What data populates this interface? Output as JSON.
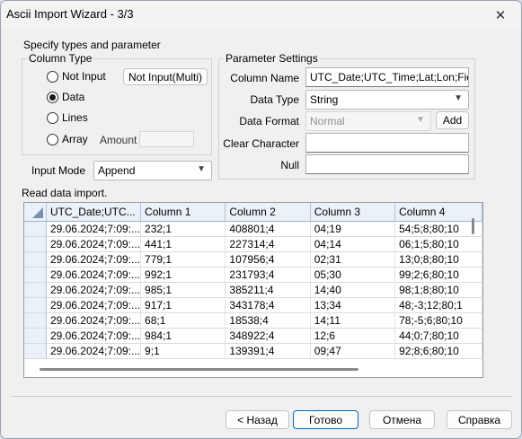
{
  "window": {
    "title": "Ascii Import Wizard  - 3/3",
    "close_symbol": "✕"
  },
  "spec": {
    "heading": "Specify types and parameter",
    "column_type": {
      "legend": "Column Type",
      "not_input": "Not Input",
      "not_input_multi": "Not Input(Multi)",
      "data": "Data",
      "lines": "Lines",
      "array": "Array",
      "amount_label": "Amount",
      "amount_value": "",
      "selected": "data"
    },
    "input_mode": {
      "label": "Input Mode",
      "value": "Append"
    }
  },
  "params": {
    "legend": "Parameter Settings",
    "column_name_label": "Column Name",
    "column_name_value": "UTC_Date;UTC_Time;Lat;Lon;Field;Ele",
    "data_type_label": "Data Type",
    "data_type_value": "String",
    "data_format_label": "Data Format",
    "data_format_value": "Normal",
    "add_button": "Add",
    "clear_char_label": "Clear Character",
    "clear_char_value": "",
    "null_label": "Null",
    "null_value": ""
  },
  "table": {
    "caption": "Read data import.",
    "headers": [
      "UTC_Date;UTC...",
      "Column 1",
      "Column 2",
      "Column 3",
      "Column 4"
    ],
    "rows": [
      [
        "29.06.2024;7:09:...",
        "232;1",
        "408801;4",
        "04;19",
        "54;5;8;80;10"
      ],
      [
        "29.06.2024;7:09:...",
        "441;1",
        "227314;4",
        "04;14",
        "06;1;5;80;10"
      ],
      [
        "29.06.2024;7:09:...",
        "779;1",
        "107956;4",
        "02;31",
        "13;0;8;80;10"
      ],
      [
        "29.06.2024;7:09:...",
        "992;1",
        "231793;4",
        "05;30",
        "99;2;6;80;10"
      ],
      [
        "29.06.2024;7:09:...",
        "985;1",
        "385211;4",
        "14;40",
        "98;1;8;80;10"
      ],
      [
        "29.06.2024;7:09:...",
        "917;1",
        "343178;4",
        "13;34",
        "48;-3;12;80;1"
      ],
      [
        "29.06.2024;7:09:...",
        "68;1",
        "18538;4",
        "14;11",
        "78;-5;6;80;10"
      ],
      [
        "29.06.2024;7:09:...",
        "984;1",
        "348922;4",
        "12;6",
        "44;0;7;80;10"
      ],
      [
        "29.06.2024;7:09:...",
        "9;1",
        "139391;4",
        "09;47",
        "92;8;6;80;10"
      ]
    ]
  },
  "footer": {
    "back": "< Назад",
    "done": "Готово",
    "cancel": "Отмена",
    "help": "Справка"
  }
}
